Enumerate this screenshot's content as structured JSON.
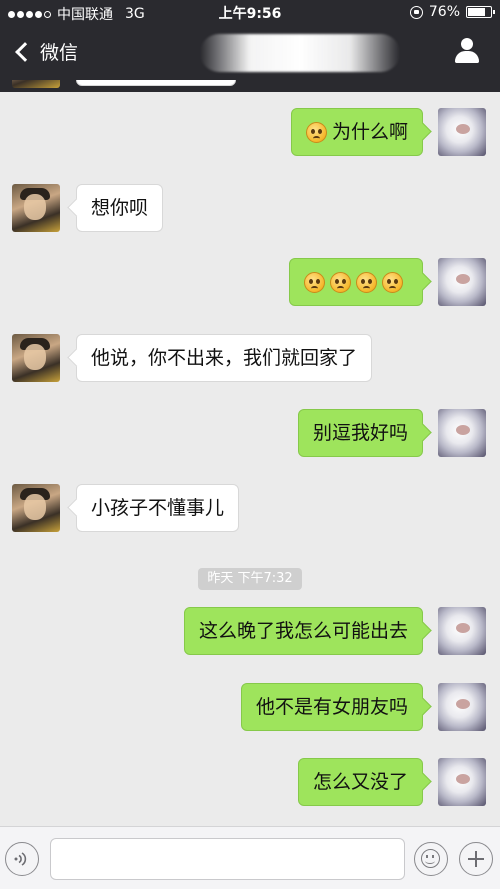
{
  "status_bar": {
    "carrier": "中国联通",
    "network": "3G",
    "time": "上午9:56",
    "battery": "76%",
    "battery_level": 0.76,
    "signal_dots_filled": 4,
    "signal_dots_total": 5
  },
  "nav": {
    "back_label": "微信",
    "back_icon": "chevron-left-icon",
    "profile_icon": "person-icon"
  },
  "messages": [
    {
      "side": "right",
      "avatar": "dog",
      "emoji_count": 1,
      "text": "为什么啊"
    },
    {
      "side": "left",
      "avatar": "boy",
      "emoji_count": 0,
      "text": "想你呗"
    },
    {
      "side": "right",
      "avatar": "dog",
      "emoji_count": 4,
      "text": ""
    },
    {
      "side": "left",
      "avatar": "boy",
      "emoji_count": 0,
      "text": "他说，你不出来，我们就回家了"
    },
    {
      "side": "right",
      "avatar": "dog",
      "emoji_count": 0,
      "text": "别逗我好吗"
    },
    {
      "side": "left",
      "avatar": "boy",
      "emoji_count": 0,
      "text": "小孩子不懂事儿"
    },
    {
      "side": "right",
      "avatar": "dog",
      "emoji_count": 0,
      "text": "这么晚了我怎么可能出去"
    },
    {
      "side": "right",
      "avatar": "dog",
      "emoji_count": 0,
      "text": "他不是有女朋友吗"
    },
    {
      "side": "right",
      "avatar": "dog",
      "emoji_count": 0,
      "text": "怎么又没了"
    }
  ],
  "timestamp": "昨天 下午7:32",
  "input": {
    "value": "",
    "placeholder": ""
  },
  "colors": {
    "bubble_sent": "#9ee45c",
    "bubble_received": "#ffffff",
    "nav_bg": "#2a2a2f",
    "chat_bg": "#ebebeb"
  }
}
